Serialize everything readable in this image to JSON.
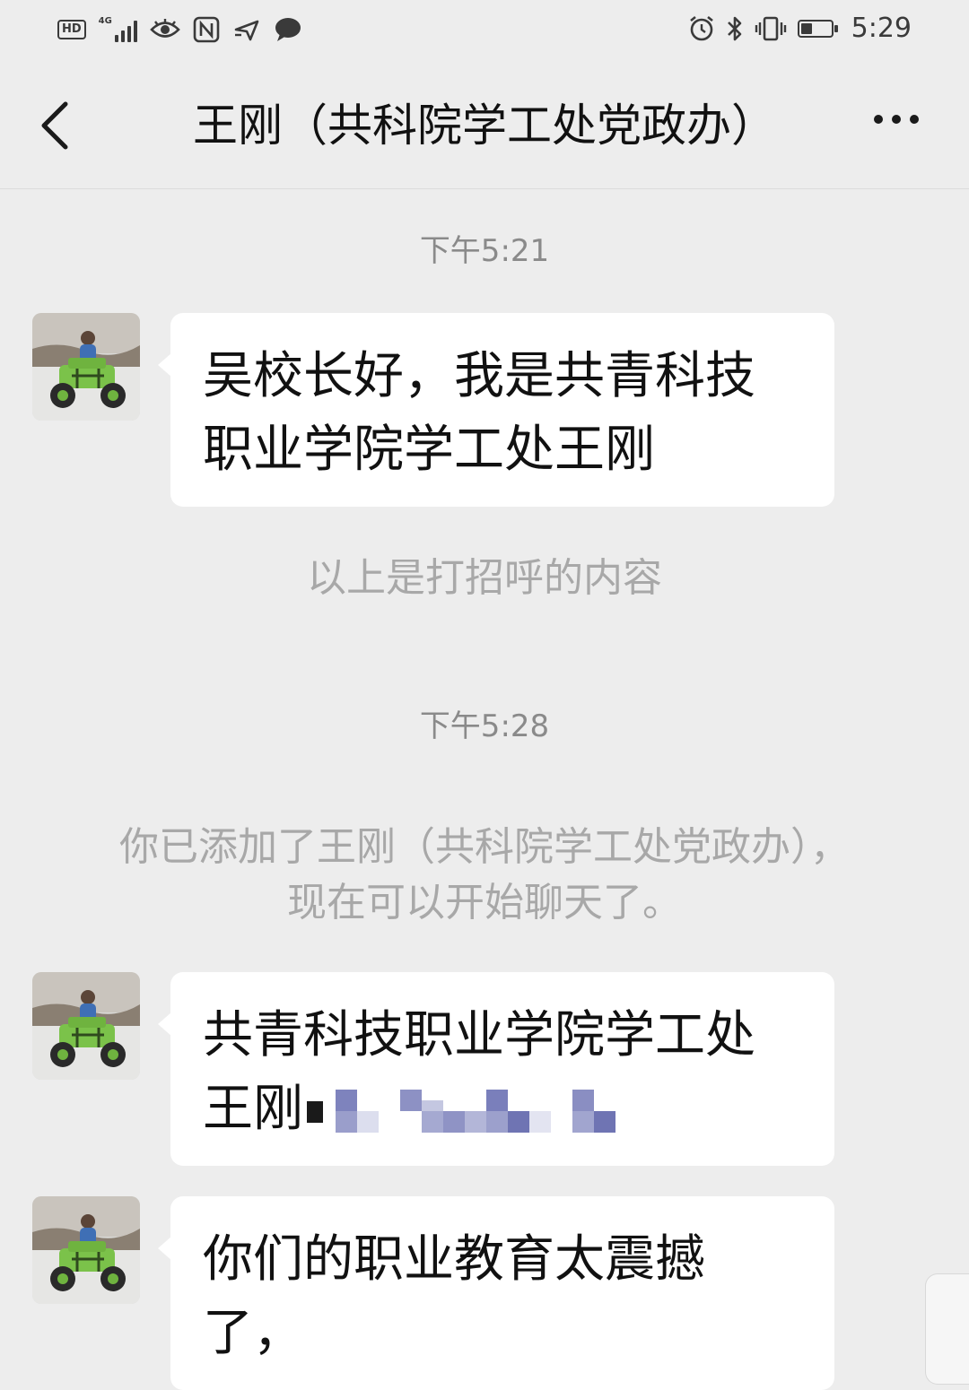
{
  "status_bar": {
    "hd_label": "HD",
    "network_label": "4G",
    "time": "5:29",
    "battery_level": 0.4,
    "icons": [
      "signal-icon",
      "eye-comfort-icon",
      "nfc-icon",
      "location-icon",
      "chat-notification-icon",
      "alarm-icon",
      "bluetooth-icon",
      "vibrate-icon",
      "battery-icon"
    ]
  },
  "nav": {
    "title": "王刚（共科院学工处党政办）",
    "back_icon": "chevron-left-icon",
    "more_icon": "more-dots-icon"
  },
  "chat": {
    "timestamp_1": "下午5:21",
    "greeting_message": "吴校长好，我是共青科技职业学院学工处王刚",
    "greeting_note": "以上是打招呼的内容",
    "timestamp_2": "下午5:28",
    "added_note_line1": "你已添加了王刚（共科院学工处党政办），",
    "added_note_line2": "现在可以开始聊天了。",
    "message_2": "共青科技职业学院学工处王刚",
    "message_3": "你们的职业教育太震撼了，"
  },
  "colors": {
    "background": "#ededed",
    "bubble": "#ffffff",
    "note_text": "#a8a8a8",
    "timestamp_text": "#8a8a8a",
    "redaction_blue": "#6f74b3"
  }
}
